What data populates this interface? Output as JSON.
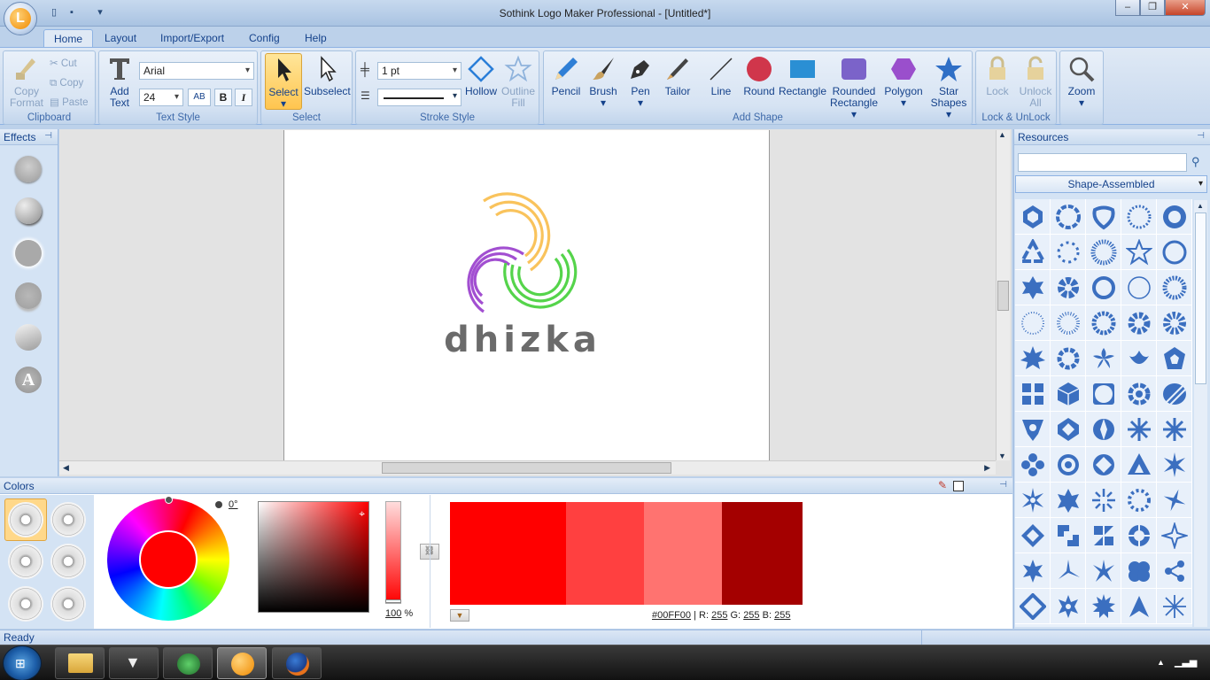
{
  "window": {
    "title": "Sothink Logo Maker Professional - [Untitled*]",
    "controls": [
      "–",
      "❐",
      "✕"
    ]
  },
  "tabs": [
    "Home",
    "Layout",
    "Import/Export",
    "Config",
    "Help"
  ],
  "ribbon": {
    "clipboard": {
      "title": "Clipboard",
      "copy_format": [
        "Copy",
        "Format"
      ],
      "cut": "Cut",
      "copy": "Copy",
      "paste": "Paste"
    },
    "text_style": {
      "title": "Text Style",
      "add_text": [
        "Add",
        "Text"
      ],
      "font": "Arial",
      "size": "24",
      "bold": "B",
      "italic": "I",
      "ab": "AB"
    },
    "select": {
      "title": "Select",
      "select": "Select",
      "subselect": "Subselect"
    },
    "stroke_style": {
      "title": "Stroke Style",
      "width": "1 pt",
      "hollow": "Hollow",
      "outline_fill": [
        "Outline",
        "Fill"
      ]
    },
    "add_shape": {
      "title": "Add Shape",
      "pencil": "Pencil",
      "brush": "Brush",
      "pen": "Pen",
      "tailor": "Tailor",
      "line": "Line",
      "round": "Round",
      "rectangle": "Rectangle",
      "rounded_rectangle": [
        "Rounded",
        "Rectangle"
      ],
      "polygon": "Polygon",
      "star_shapes": [
        "Star",
        "Shapes"
      ]
    },
    "lock_unlock": {
      "title": "Lock & UnLock",
      "lock": "Lock",
      "unlock_all": [
        "Unlock",
        "All"
      ],
      "zoom": "Zoom"
    }
  },
  "effects": {
    "title": "Effects"
  },
  "canvas": {
    "logo_text": "dhizka",
    "colors": {
      "yellow": "#f9c35c",
      "purple": "#a24fd1",
      "green": "#55d44b",
      "text": "#6b6b6b"
    }
  },
  "resources": {
    "title": "Resources",
    "search_placeholder": "",
    "category": "Shape-Assembled"
  },
  "colors": {
    "title": "Colors",
    "hue_angle": "0°",
    "opacity": "100",
    "opacity_unit": "%",
    "current": "#FF0000",
    "swatches": [
      "#ff0000",
      "#ff4040",
      "#ff7370",
      "#a40000"
    ],
    "hex": "#00FF00",
    "r_label": "R:",
    "r": "255",
    "g_label": "G:",
    "g": "255",
    "b_label": "B:",
    "b": "255"
  },
  "status": {
    "text": "Ready"
  }
}
